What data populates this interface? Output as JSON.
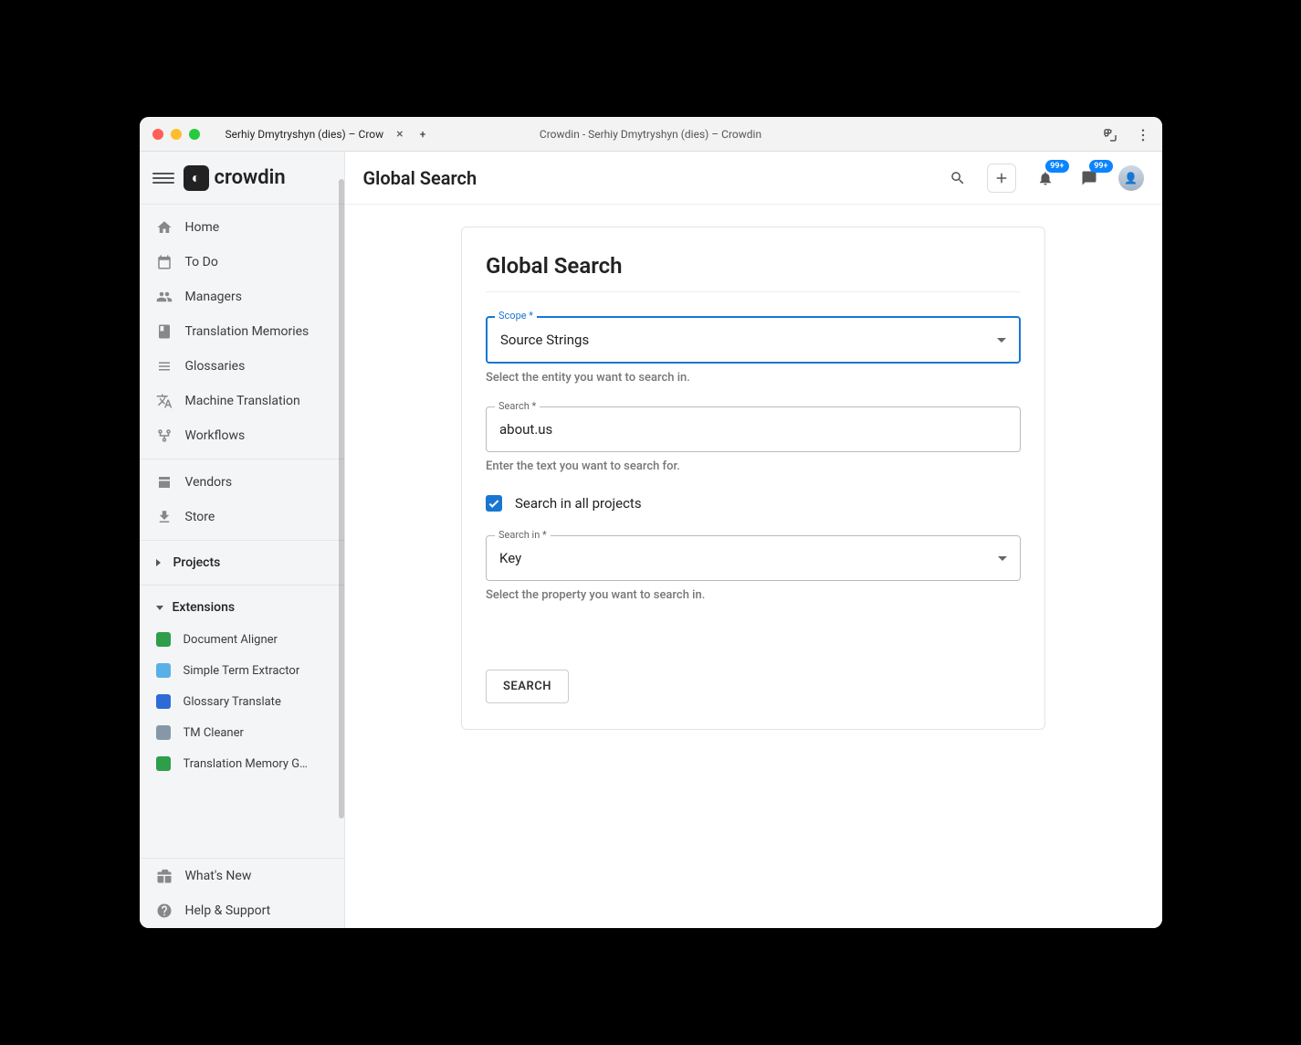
{
  "browser": {
    "tab_title": "Serhiy Dmytryshyn (dies) – Crow",
    "window_title": "Crowdin - Serhiy Dmytryshyn (dies) – Crowdin",
    "new_tab_plus": "+"
  },
  "brand": "crowdin",
  "sidebar": {
    "items": [
      {
        "label": "Home"
      },
      {
        "label": "To Do"
      },
      {
        "label": "Managers"
      },
      {
        "label": "Translation Memories"
      },
      {
        "label": "Glossaries"
      },
      {
        "label": "Machine Translation"
      },
      {
        "label": "Workflows"
      }
    ],
    "group2": [
      {
        "label": "Vendors"
      },
      {
        "label": "Store"
      }
    ],
    "projects_label": "Projects",
    "extensions_label": "Extensions",
    "extensions": [
      {
        "label": "Document Aligner",
        "color": "#2e9e4b"
      },
      {
        "label": "Simple Term Extractor",
        "color": "#5ab0e6"
      },
      {
        "label": "Glossary Translate",
        "color": "#2f6bd6"
      },
      {
        "label": "TM Cleaner",
        "color": "#8698a8"
      },
      {
        "label": "Translation Memory Ge...",
        "color": "#2e9e4b"
      }
    ],
    "footer": [
      {
        "label": "What's New"
      },
      {
        "label": "Help & Support"
      }
    ]
  },
  "topbar": {
    "title": "Global Search",
    "notif_badge": "99+",
    "msg_badge": "99+"
  },
  "card": {
    "title": "Global Search",
    "scope_label": "Scope *",
    "scope_value": "Source Strings",
    "scope_helper": "Select the entity you want to search in.",
    "search_label": "Search *",
    "search_value": "about.us",
    "search_helper": "Enter the text you want to search for.",
    "checkbox_label": "Search in all projects",
    "checkbox_checked": true,
    "searchin_label": "Search in *",
    "searchin_value": "Key",
    "searchin_helper": "Select the property you want to search in.",
    "button": "SEARCH"
  }
}
